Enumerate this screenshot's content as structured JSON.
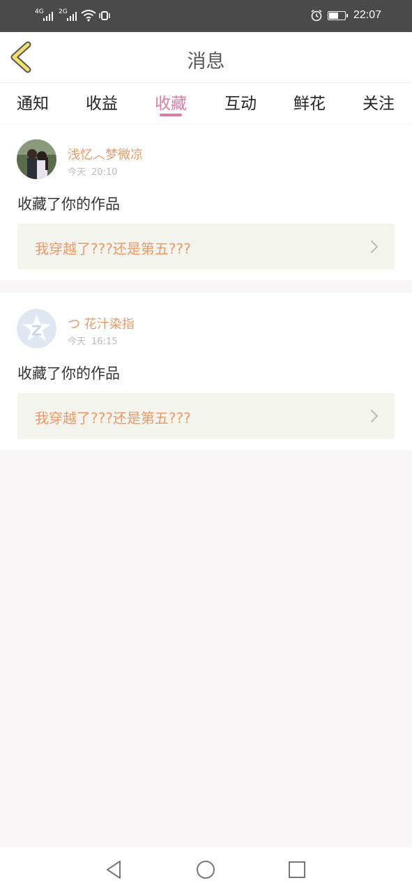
{
  "status_bar": {
    "signal_1": "4G",
    "signal_2": "2G",
    "time": "22:07"
  },
  "header": {
    "title": "消息",
    "back_icon": "chevron-left-icon"
  },
  "tabs": [
    {
      "label": "通知",
      "active": false
    },
    {
      "label": "收益",
      "active": false
    },
    {
      "label": "收藏",
      "active": true
    },
    {
      "label": "互动",
      "active": false
    },
    {
      "label": "鲜花",
      "active": false
    },
    {
      "label": "关注",
      "active": false
    }
  ],
  "messages": [
    {
      "username": "浅忆︿梦微凉",
      "date": "今天",
      "time": "20:10",
      "action": "收藏了你的作品",
      "work_title": "我穿越了???还是第五???",
      "avatar": "photo-avatar"
    },
    {
      "username": "つ 花汁染指",
      "date": "今天",
      "time": "16:15",
      "action": "收藏了你的作品",
      "work_title": "我穿越了???还是第五???",
      "avatar": "default-avatar"
    }
  ],
  "colors": {
    "accent": "#e07aa6",
    "username": "#ea9a6a",
    "work_box": "#f4f4ee",
    "status_bar": "#4a4a4a",
    "back_icon": "#f1e070"
  },
  "nav": {
    "back": "triangle-back-icon",
    "home": "circle-home-icon",
    "recent": "square-recent-icon"
  }
}
